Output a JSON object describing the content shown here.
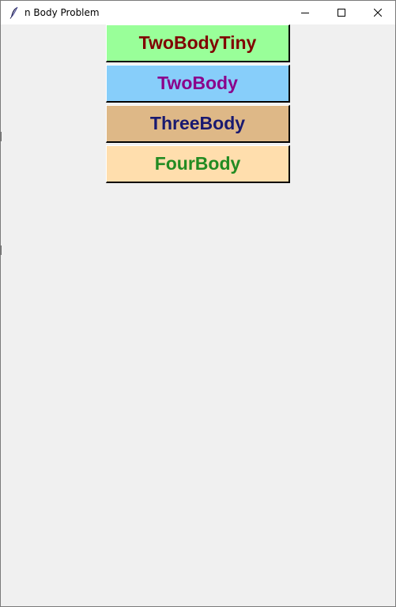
{
  "window": {
    "title": "n Body Problem"
  },
  "title_bar": {
    "icon": "feather-icon",
    "controls": [
      "minimize-icon",
      "maximize-icon",
      "close-icon"
    ]
  },
  "menu": {
    "buttons": [
      {
        "label": "TwoBodyTiny",
        "bg": "#99ff99",
        "fg": "#800000"
      },
      {
        "label": "TwoBody",
        "bg": "#87cefa",
        "fg": "#8b008b"
      },
      {
        "label": "ThreeBody",
        "bg": "#deb887",
        "fg": "#191970"
      },
      {
        "label": "FourBody",
        "bg": "#ffdead",
        "fg": "#228b22"
      }
    ]
  }
}
